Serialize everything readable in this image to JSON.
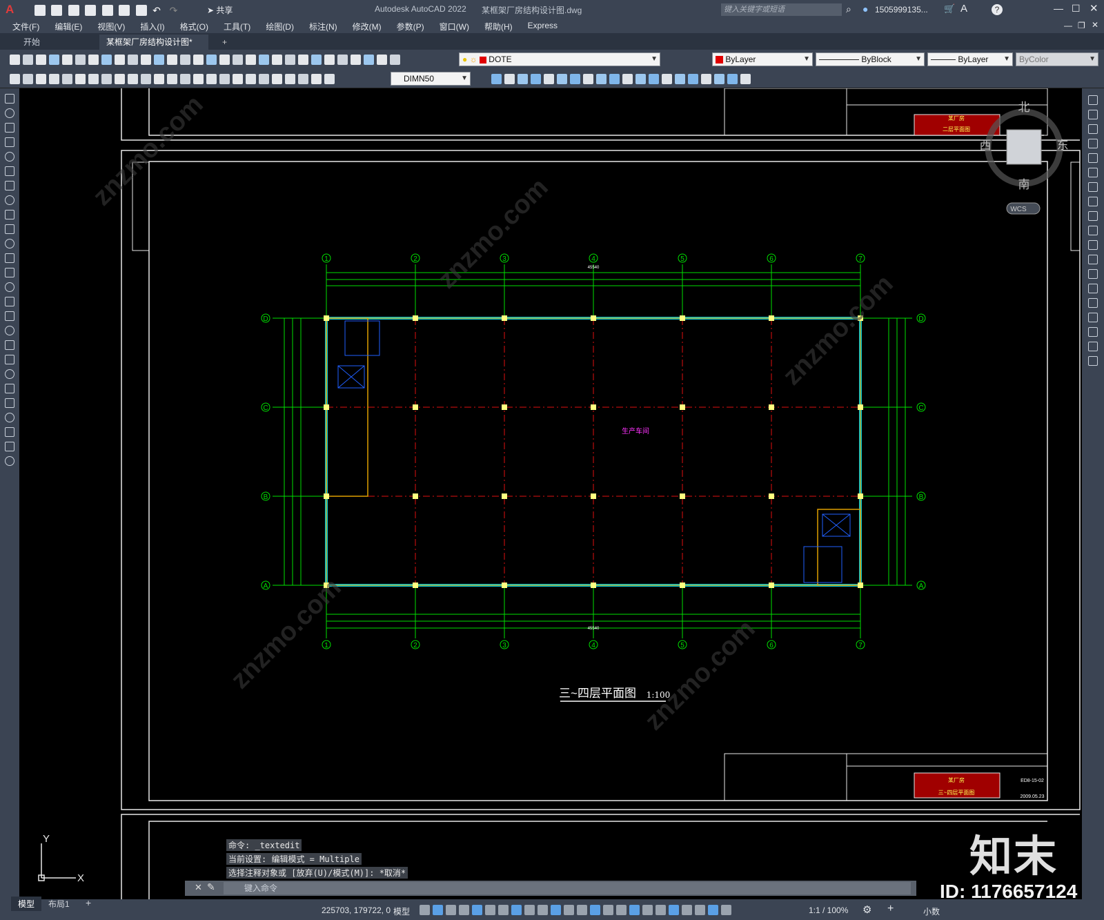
{
  "window": {
    "app_title": "Autodesk AutoCAD 2022",
    "file_title": "某框架厂房结构设计图.dwg",
    "share_label": "共享",
    "search_placeholder": "键入关键字或短语",
    "user": "1505999135..."
  },
  "menu": [
    "文件(F)",
    "编辑(E)",
    "视图(V)",
    "插入(I)",
    "格式(O)",
    "工具(T)",
    "绘图(D)",
    "标注(N)",
    "修改(M)",
    "参数(P)",
    "窗口(W)",
    "帮助(H)",
    "Express"
  ],
  "tabs": {
    "start": "开始",
    "doc": "某框架厂房结构设计图*",
    "close": "✕",
    "add": "+"
  },
  "toolbar": {
    "layer": "DOTE",
    "color": "ByLayer",
    "linetype": "ByBlock",
    "lineweight": "ByLayer",
    "plotstyle": "ByColor",
    "dimstyle": "DIMN50"
  },
  "viewcube": {
    "north": "北",
    "south": "南",
    "east": "东",
    "west": "西",
    "wcs": "WCS"
  },
  "drawing": {
    "title": "三~四层平面图",
    "scale": "1:100",
    "room_label": "生产车间",
    "axis_columns": [
      "1",
      "2",
      "3",
      "4",
      "5",
      "6",
      "7"
    ],
    "axis_rows": [
      "D",
      "C",
      "B",
      "A"
    ],
    "total_dim": "45540",
    "title_block": {
      "project": "某厂房",
      "sheet_top": "二层平面图",
      "sheet_bottom": "三~四层平面图",
      "code": "ED8-15-02",
      "date": "2009.05.23"
    }
  },
  "ucs": {
    "x": "X",
    "y": "Y"
  },
  "command": {
    "history": [
      "命令: _textedit",
      "当前设置: 编辑模式 = Multiple",
      "选择注释对象或 [放弃(U)/模式(M)]: *取消*"
    ],
    "placeholder": "键入命令"
  },
  "status": {
    "tab_model": "模型",
    "tab_layout": "布局1",
    "tab_add": "+",
    "coords": "225703, 179722, 0",
    "space": "模型",
    "scale": "1:1 / 100%",
    "units": "小数"
  },
  "watermark": {
    "brand": "知末",
    "id": "ID: 1176657124",
    "site": "znzmo.com"
  }
}
